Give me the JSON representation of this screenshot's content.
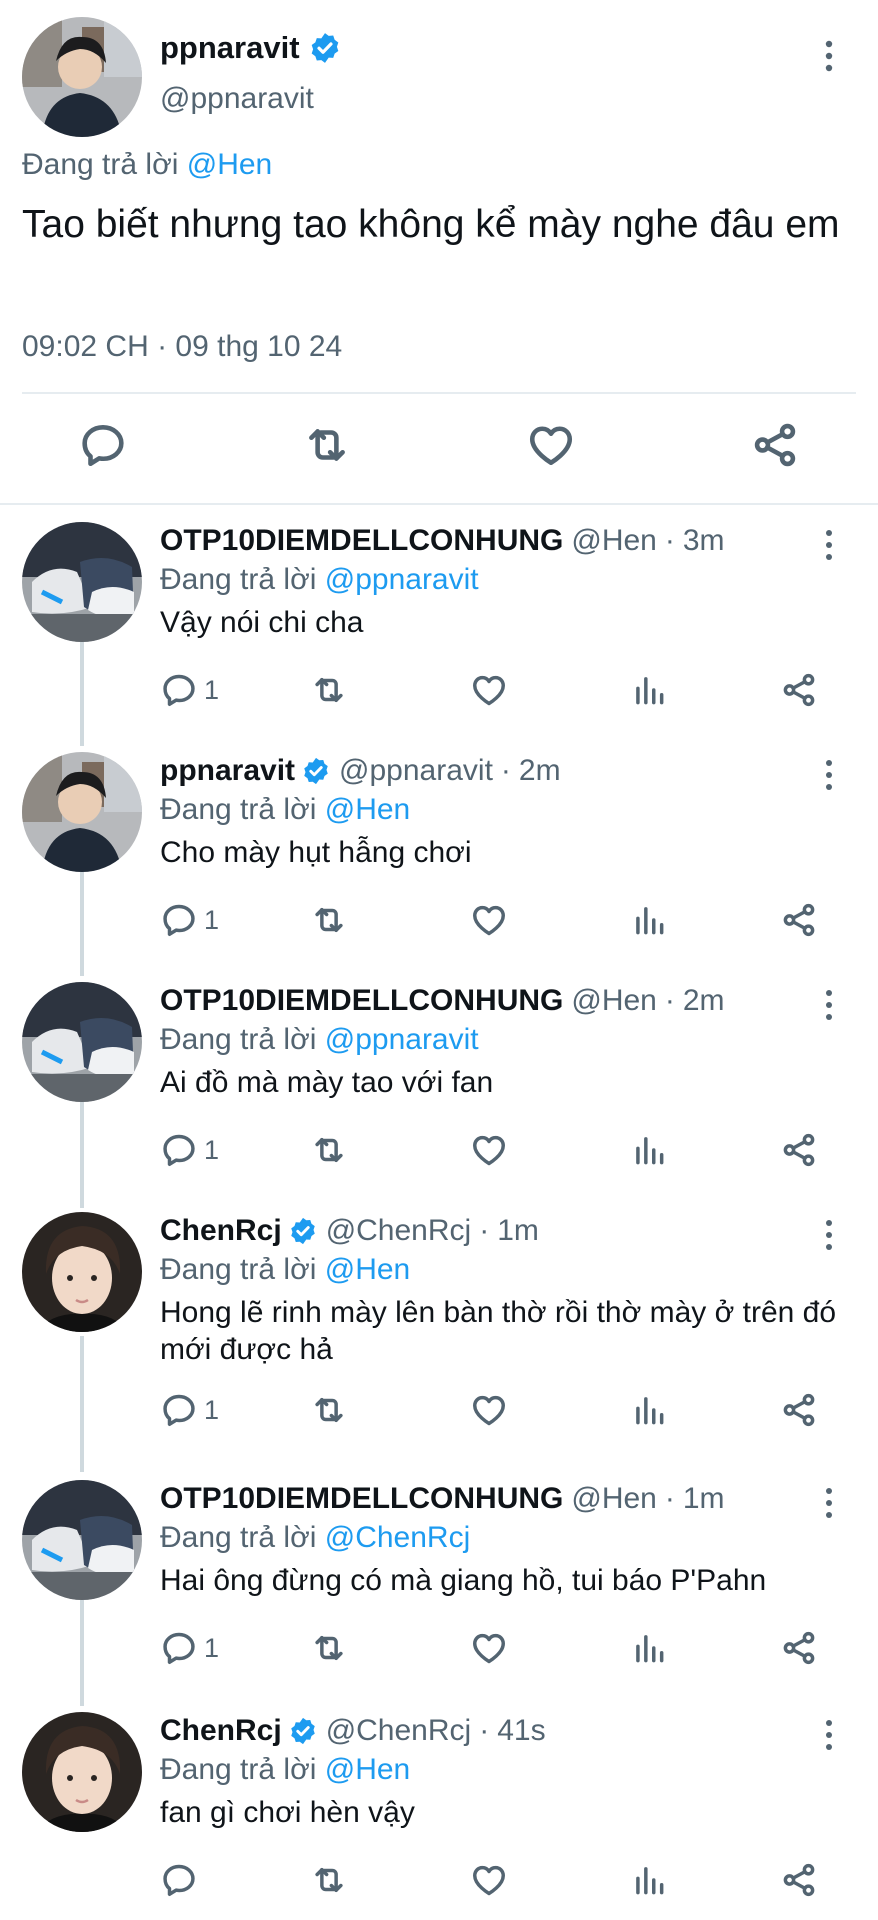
{
  "main_tweet": {
    "display_name": "ppnaravit",
    "handle": "@ppnaravit",
    "replying_prefix": "Đang trả lời",
    "replying_to": "@Hen",
    "text": "Tao biết nhưng tao không kể mày nghe đâu em",
    "timestamp": "09:02 CH · 09 thg 10 24",
    "actions": [
      "reply-icon",
      "retweet-icon",
      "like-icon",
      "share-icon"
    ]
  },
  "replies": [
    {
      "display_name": "OTP10DIEMDELLCONHUNG",
      "verified": false,
      "handle": "@Hen",
      "time": "3m",
      "replying_prefix": "Đang trả lời",
      "replying_to": "@ppnaravit",
      "text": "Vậy nói chi cha",
      "reply_count": "1",
      "avatar": "shoes"
    },
    {
      "display_name": "ppnaravit",
      "verified": true,
      "handle": "@ppnaravit",
      "time": "2m",
      "replying_prefix": "Đang trả lời",
      "replying_to": "@Hen",
      "text": "Cho mày hụt hẫng chơi",
      "reply_count": "1",
      "avatar": "person-outdoor"
    },
    {
      "display_name": "OTP10DIEMDELLCONHUNG",
      "verified": false,
      "handle": "@Hen",
      "time": "2m",
      "replying_prefix": "Đang trả lời",
      "replying_to": "@ppnaravit",
      "text": "Ai đồ mà mày tao với fan",
      "reply_count": "1",
      "avatar": "shoes"
    },
    {
      "display_name": "ChenRcj",
      "verified": true,
      "handle": "@ChenRcj",
      "time": "1m",
      "replying_prefix": "Đang trả lời",
      "replying_to": "@Hen",
      "text": "Hong lẽ rinh mày lên bàn thờ rồi thờ mày ở trên đó mới được hả",
      "reply_count": "1",
      "avatar": "person-portrait"
    },
    {
      "display_name": "OTP10DIEMDELLCONHUNG",
      "verified": false,
      "handle": "@Hen",
      "time": "1m",
      "replying_prefix": "Đang trả lời",
      "replying_to": "@ChenRcj",
      "text": "Hai ông đừng có mà giang hồ, tui báo P'Pahn",
      "reply_count": "1",
      "avatar": "shoes"
    },
    {
      "display_name": "ChenRcj",
      "verified": true,
      "handle": "@ChenRcj",
      "time": "41s",
      "replying_prefix": "Đang trả lời",
      "replying_to": "@Hen",
      "text": "fan gì chơi hèn vậy",
      "reply_count": "",
      "avatar": "person-portrait"
    }
  ],
  "colors": {
    "link": "#1d9bf0",
    "secondary_text": "#536471",
    "primary_text": "#0f1419",
    "verified": "#1d9bf0",
    "divider": "#e6ecf0"
  }
}
